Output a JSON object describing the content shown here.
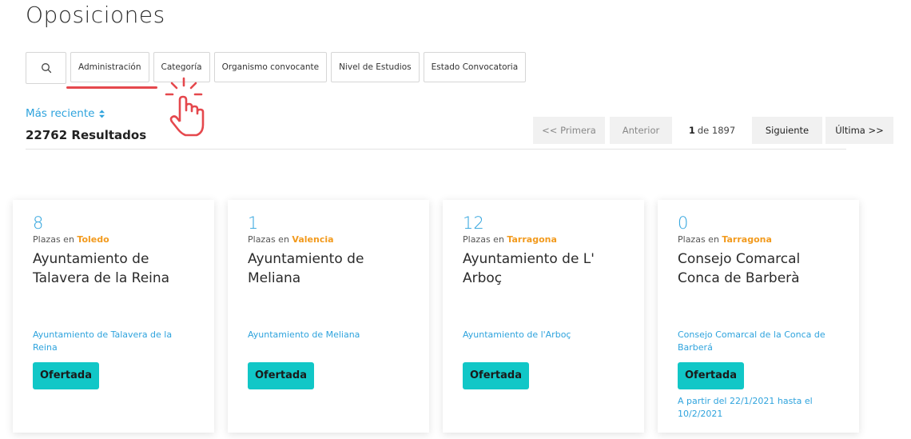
{
  "page": {
    "title": "Oposiciones"
  },
  "filters": {
    "search_icon": "search-icon",
    "items": [
      {
        "label": "Administración"
      },
      {
        "label": "Categoría"
      },
      {
        "label": "Organismo convocante"
      },
      {
        "label": "Nivel de Estudios"
      },
      {
        "label": "Estado Convocatoria"
      }
    ]
  },
  "sort": {
    "label": "Más reciente",
    "icon": "sort-icon"
  },
  "results": {
    "text": "22762 Resultados"
  },
  "pagination": {
    "first": "<< Primera",
    "prev": "Anterior",
    "current": "1",
    "of_total": "de 1897",
    "next": "Siguiente",
    "last": "Última >>"
  },
  "cards": [
    {
      "count": "8",
      "place_prefix": "Plazas en",
      "place": "Toledo",
      "title": "Ayuntamiento de Talavera de la Reina",
      "org": "Ayuntamiento de Talavera de la Reina",
      "status": "Ofertada",
      "dates": ""
    },
    {
      "count": "1",
      "place_prefix": "Plazas en",
      "place": "Valencia",
      "title": "Ayuntamiento de Meliana",
      "org": "Ayuntamiento de Meliana",
      "status": "Ofertada",
      "dates": ""
    },
    {
      "count": "12",
      "place_prefix": "Plazas en",
      "place": "Tarragona",
      "title": "Ayuntamiento de L' Arboç",
      "org": "Ayuntamiento de l'Arboç",
      "status": "Ofertada",
      "dates": ""
    },
    {
      "count": "0",
      "place_prefix": "Plazas en",
      "place": "Tarragona",
      "title": "Consejo Comarcal Conca de Barberà",
      "org": "Consejo Comarcal de la Conca de Barberá",
      "status": "Ofertada",
      "dates": "A partir del 22/1/2021 hasta el 10/2/2021"
    }
  ],
  "colors": {
    "accent_blue": "#2ea3dd",
    "place_orange": "#f29a1d",
    "badge_teal": "#11c7c7",
    "highlight_red": "#e5484d"
  }
}
